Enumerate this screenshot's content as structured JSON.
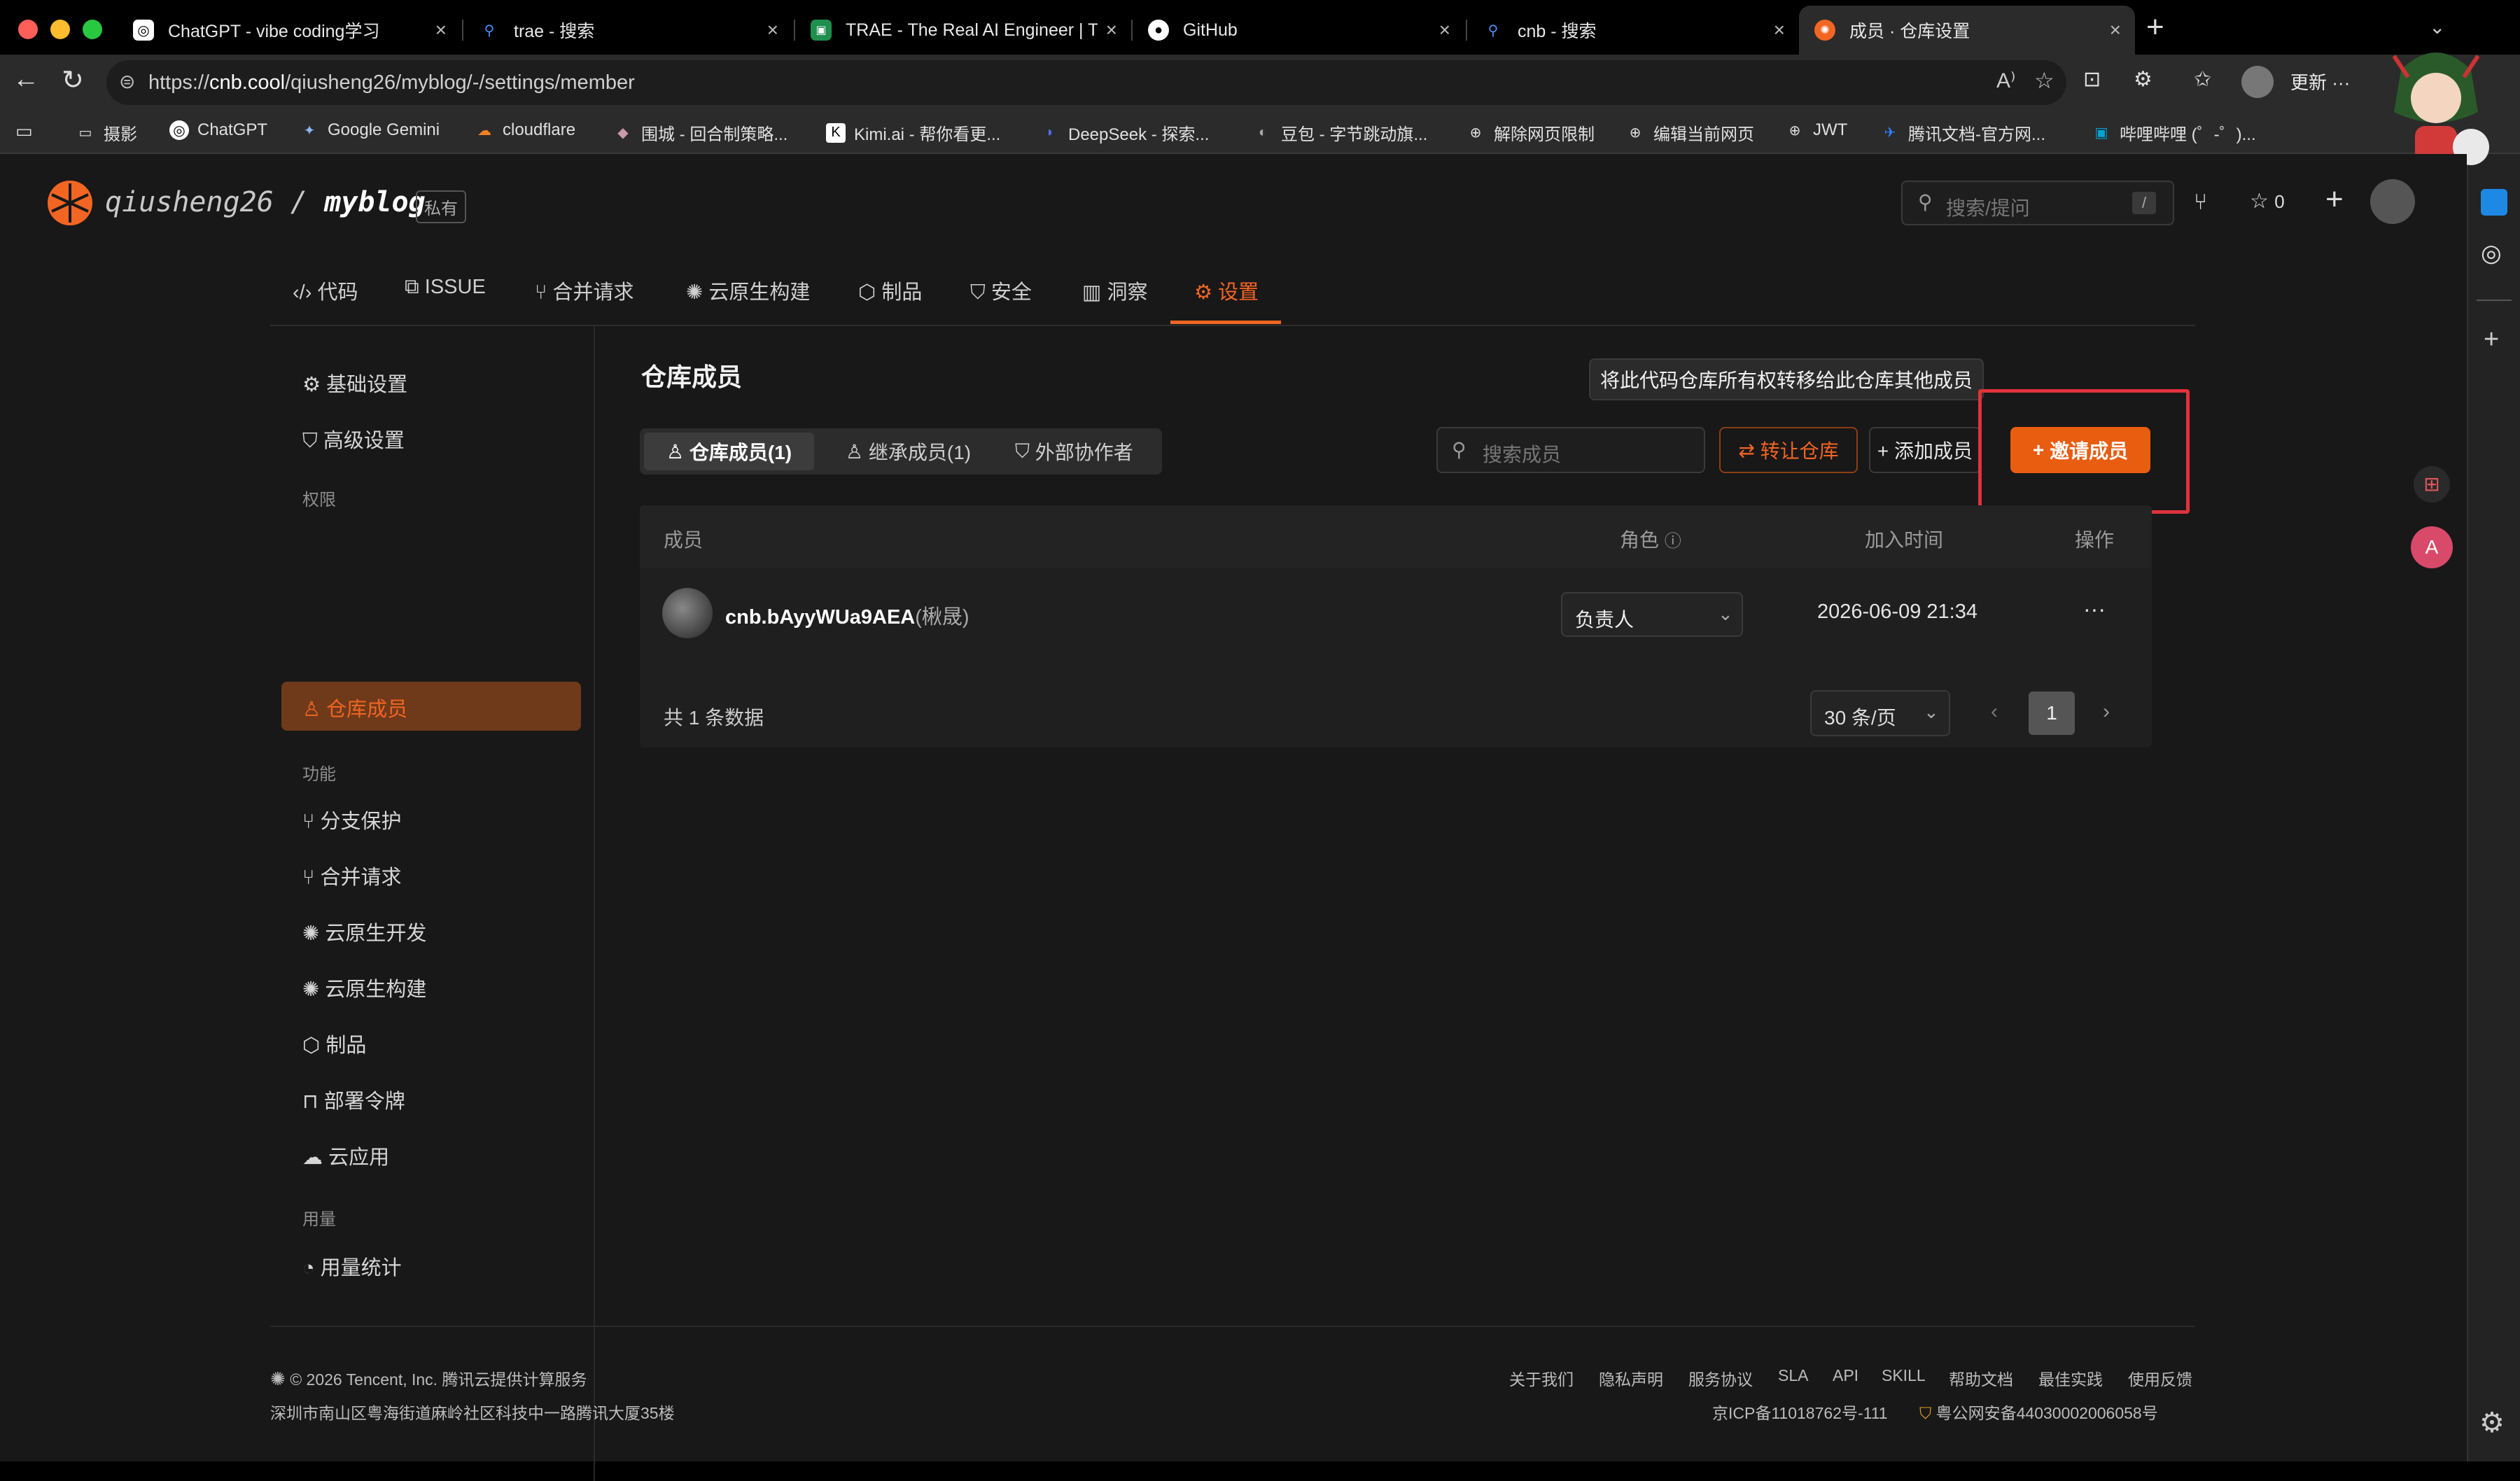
{
  "browser": {
    "tabs": [
      {
        "label": "ChatGPT - vibe coding学习",
        "icon": "chatgpt-icon"
      },
      {
        "label": "trae - 搜索",
        "icon": "search-icon"
      },
      {
        "label": "TRAE - The Real AI Engineer | TRAE",
        "icon": "trae-icon"
      },
      {
        "label": "GitHub",
        "icon": "github-icon"
      },
      {
        "label": "cnb - 搜索",
        "icon": "search-icon"
      },
      {
        "label": "成员 · 仓库设置",
        "icon": "cnb-icon"
      }
    ],
    "new_tab": "+",
    "url_prefix": "https://",
    "url_host": "cnb.cool",
    "url_path": "/qiusheng26/myblog/-/settings/member",
    "update_label": "更新",
    "more": "···",
    "bookmarks": [
      "摄影",
      "ChatGPT",
      "Google Gemini",
      "cloudflare",
      "围城 - 回合制策略...",
      "Kimi.ai - 帮你看更...",
      "DeepSeek - 探索...",
      "豆包 - 字节跳动旗...",
      "解除网页限制",
      "编辑当前网页",
      "JWT",
      "腾讯文档-官方网...",
      "哔哩哔哩 (゜-゜)..."
    ]
  },
  "header": {
    "owner": "qiusheng26",
    "slash": "/",
    "repo": "myblog",
    "visibility": "私有",
    "search_placeholder": "搜索/提问",
    "search_shortcut": "/",
    "star_count": "0",
    "plus": "+"
  },
  "repo_nav": [
    {
      "label": "代码",
      "icon": "code-icon"
    },
    {
      "label": "ISSUE",
      "icon": "issue-icon"
    },
    {
      "label": "合并请求",
      "icon": "merge-request-icon"
    },
    {
      "label": "云原生构建",
      "icon": "build-icon"
    },
    {
      "label": "制品",
      "icon": "package-icon"
    },
    {
      "label": "安全",
      "icon": "shield-icon"
    },
    {
      "label": "洞察",
      "icon": "insight-icon"
    },
    {
      "label": "设置",
      "icon": "settings-icon",
      "active": true
    }
  ],
  "settings_sidebar": {
    "items_top": [
      "基础设置",
      "高级设置"
    ],
    "group_permissions": "权限",
    "members": "仓库成员",
    "group_features": "功能",
    "features": [
      "分支保护",
      "合并请求",
      "云原生开发",
      "云原生构建",
      "制品",
      "部署令牌",
      "云应用"
    ],
    "group_usage": "用量",
    "usage": [
      "用量统计"
    ]
  },
  "main": {
    "title": "仓库成员",
    "segments": [
      "仓库成员(1)",
      "继承成员(1)",
      "外部协作者"
    ],
    "search_placeholder": "搜索成员",
    "transfer_label": "转让仓库",
    "add_label": "+ 添加成员",
    "invite_label": "邀请成员",
    "tooltip": "将此代码仓库所有权转移给此仓库其他成员",
    "table": {
      "headers": [
        "成员",
        "角色",
        "加入时间",
        "操作"
      ],
      "rows": [
        {
          "name": "cnb.bAyyWUa9AEA",
          "nickname": "(楸晟)",
          "role": "负责人",
          "joined": "2026-06-09 21:34",
          "action": "···"
        }
      ],
      "total": "共 1 条数据",
      "page_size": "30 条/页",
      "page": "1"
    }
  },
  "footer": {
    "copyright": "© 2026 Tencent, Inc. 腾讯云提供计算服务",
    "address": "深圳市南山区粤海街道麻岭社区科技中一路腾讯大厦35楼",
    "links": [
      "关于我们",
      "隐私声明",
      "服务协议",
      "SLA",
      "API",
      "SKILL",
      "帮助文档",
      "最佳实践",
      "使用反馈"
    ],
    "icp": "京ICP备11018762号-111",
    "police": "粤公网安备44030002006058号"
  },
  "colors": {
    "accent": "#f26522",
    "highlight": "#e0323b"
  }
}
